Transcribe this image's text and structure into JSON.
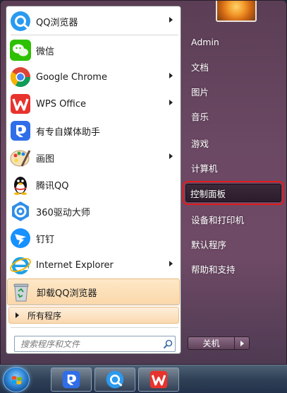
{
  "start_menu": {
    "programs": [
      {
        "label": "QQ浏览器",
        "icon": "qq-browser-icon",
        "has_submenu": true
      },
      {
        "label": "微信",
        "icon": "wechat-icon",
        "has_submenu": false
      },
      {
        "label": "Google Chrome",
        "icon": "chrome-icon",
        "has_submenu": true
      },
      {
        "label": "WPS Office",
        "icon": "wps-icon",
        "has_submenu": true
      },
      {
        "label": "有专自媒体助手",
        "icon": "media-assistant-icon",
        "has_submenu": false
      },
      {
        "label": "画图",
        "icon": "paint-icon",
        "has_submenu": true
      },
      {
        "label": "腾讯QQ",
        "icon": "qq-penguin-icon",
        "has_submenu": false
      },
      {
        "label": "360驱动大师",
        "icon": "360-driver-icon",
        "has_submenu": false
      },
      {
        "label": "钉钉",
        "icon": "dingtalk-icon",
        "has_submenu": false
      },
      {
        "label": "Internet Explorer",
        "icon": "ie-icon",
        "has_submenu": true
      },
      {
        "label": "卸载QQ浏览器",
        "icon": "recycle-bin-icon",
        "has_submenu": false,
        "highlighted": true
      }
    ],
    "all_programs_label": "所有程序",
    "search_placeholder": "搜索程序和文件",
    "right_items": [
      {
        "label": "Admin"
      },
      {
        "label": "文档"
      },
      {
        "label": "图片"
      },
      {
        "label": "音乐"
      },
      {
        "label": "游戏"
      },
      {
        "label": "计算机"
      },
      {
        "label": "控制面板",
        "active": true
      },
      {
        "label": "设备和打印机"
      },
      {
        "label": "默认程序"
      },
      {
        "label": "帮助和支持"
      }
    ],
    "shutdown_label": "关机"
  },
  "taskbar": {
    "pinned": [
      {
        "icon": "media-assistant-icon"
      },
      {
        "icon": "qq-browser-icon"
      },
      {
        "icon": "wps-icon"
      }
    ]
  },
  "colors": {
    "highlight": "#fcd7a9",
    "active_outline": "#e21b1b",
    "menu_right_bg": "#6b4864"
  }
}
